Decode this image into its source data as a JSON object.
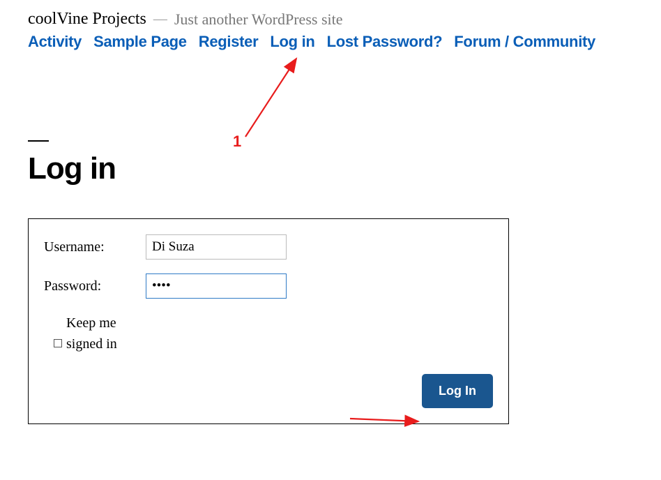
{
  "header": {
    "site_title": "coolVine Projects",
    "separator": "—",
    "tagline": "Just another WordPress site"
  },
  "nav": {
    "items": [
      {
        "label": "Activity"
      },
      {
        "label": "Sample Page"
      },
      {
        "label": "Register"
      },
      {
        "label": "Log in"
      },
      {
        "label": "Lost Password?"
      },
      {
        "label": "Forum / Community"
      }
    ]
  },
  "page": {
    "title": "Log in"
  },
  "form": {
    "username_label": "Username:",
    "username_value": "Di Suza",
    "password_label": "Password:",
    "password_value": "••••",
    "keep_signed_in_label": "Keep me signed in",
    "submit_label": "Log In"
  },
  "annotations": {
    "num1": "1"
  }
}
